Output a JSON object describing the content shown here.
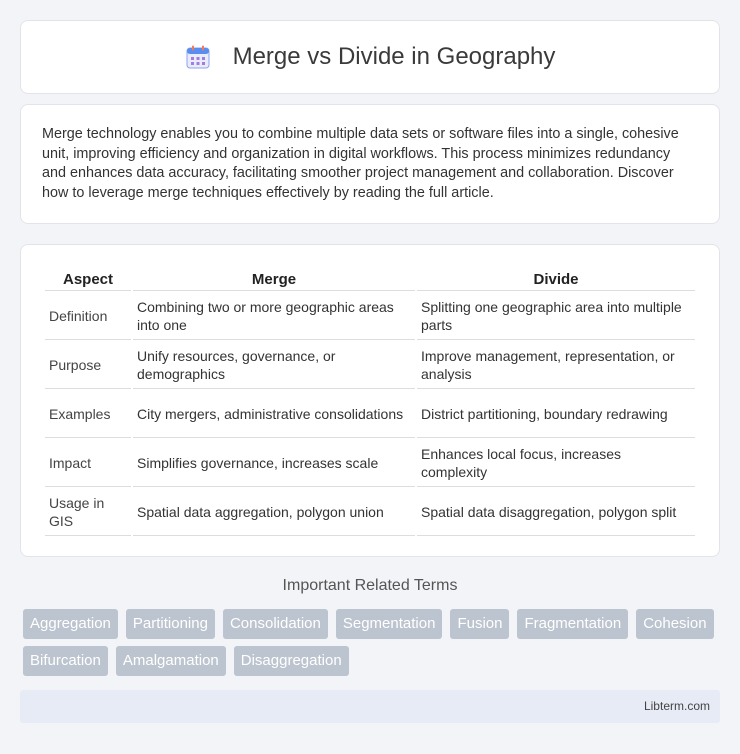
{
  "header": {
    "title": "Merge vs Divide in Geography",
    "icon": "calendar-icon"
  },
  "intro": {
    "text": "Merge technology enables you to combine multiple data sets or software files into a single, cohesive unit, improving efficiency and organization in digital workflows. This process minimizes redundancy and enhances data accuracy, facilitating smoother project management and collaboration. Discover how to leverage merge techniques effectively by reading the full article."
  },
  "table": {
    "headers": [
      "Aspect",
      "Merge",
      "Divide"
    ],
    "rows": [
      [
        "Definition",
        "Combining two or more geographic areas into one",
        "Splitting one geographic area into multiple parts"
      ],
      [
        "Purpose",
        "Unify resources, governance, or demographics",
        "Improve management, representation, or analysis"
      ],
      [
        "Examples",
        "City mergers, administrative consolidations",
        "District partitioning, boundary redrawing"
      ],
      [
        "Impact",
        "Simplifies governance, increases scale",
        "Enhances local focus, increases complexity"
      ],
      [
        "Usage in GIS",
        "Spatial data aggregation, polygon union",
        "Spatial data disaggregation, polygon split"
      ]
    ]
  },
  "related": {
    "title": "Important Related Terms",
    "tags": [
      "Aggregation",
      "Partitioning",
      "Consolidation",
      "Segmentation",
      "Fusion",
      "Fragmentation",
      "Cohesion",
      "Bifurcation",
      "Amalgamation",
      "Disaggregation"
    ]
  },
  "footer": {
    "text": "Libterm.com"
  },
  "colors": {
    "tag_bg": "#bcc4cf",
    "footer_bg": "#e6ebf5",
    "logo_accent": "#5b8def"
  }
}
